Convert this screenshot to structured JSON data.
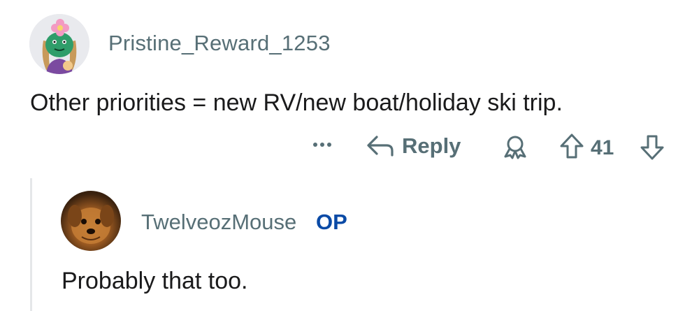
{
  "comment1": {
    "username": "Pristine_Reward_1253",
    "body": "Other priorities  = new RV/new boat/holiday ski trip.",
    "actions": {
      "more_icon": "ellipsis-icon",
      "reply_label": "Reply",
      "award_icon": "award-icon",
      "score": "41"
    }
  },
  "comment2": {
    "username": "TwelveozMouse",
    "badge": "OP",
    "body": "Probably that too."
  },
  "colors": {
    "muted": "#576f76",
    "op": "#0a4aa6",
    "text": "#1a1a1b"
  }
}
